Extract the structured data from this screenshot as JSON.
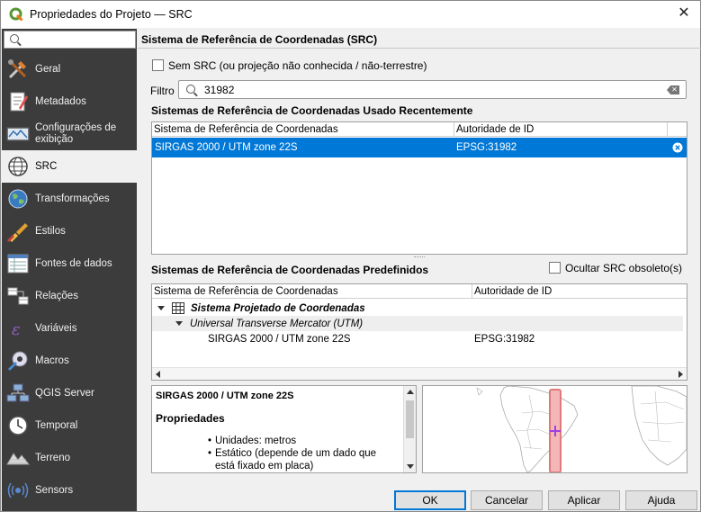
{
  "window": {
    "title": "Propriedades do Projeto — SRC"
  },
  "sidebar": {
    "search_placeholder": "",
    "items": [
      {
        "label": "Geral",
        "icon": "tools-icon"
      },
      {
        "label": "Metadados",
        "icon": "metadata-icon"
      },
      {
        "label": "Configurações de exibição",
        "icon": "display-settings-icon"
      },
      {
        "label": "SRC",
        "icon": "globe-icon"
      },
      {
        "label": "Transformações",
        "icon": "transform-globe-icon"
      },
      {
        "label": "Estilos",
        "icon": "brush-icon"
      },
      {
        "label": "Fontes de dados",
        "icon": "data-sources-icon"
      },
      {
        "label": "Relações",
        "icon": "relations-icon"
      },
      {
        "label": "Variáveis",
        "icon": "variables-icon"
      },
      {
        "label": "Macros",
        "icon": "macros-icon"
      },
      {
        "label": "QGIS Server",
        "icon": "server-icon"
      },
      {
        "label": "Temporal",
        "icon": "clock-icon"
      },
      {
        "label": "Terreno",
        "icon": "terrain-icon"
      },
      {
        "label": "Sensors",
        "icon": "sensor-icon"
      }
    ],
    "active_index": 3
  },
  "main": {
    "header": "Sistema de Referência de Coordenadas (SRC)",
    "no_crs_label": "Sem SRC (ou projeção não conhecida / não-terrestre)",
    "filter_label": "Filtro",
    "filter_value": "31982",
    "recent": {
      "title": "Sistemas de Referência de Coordenadas Usado Recentemente",
      "col_crs": "Sistema de Referência de Coordenadas",
      "col_auth": "Autoridade de ID",
      "rows": [
        {
          "crs": "SIRGAS 2000 / UTM zone 22S",
          "auth": "EPSG:31982"
        }
      ]
    },
    "predefined": {
      "title": "Sistemas de Referência de Coordenadas Predefinidos",
      "hide_deprecated_label": "Ocultar SRC obsoleto(s)",
      "col_crs": "Sistema de Referência de Coordenadas",
      "col_auth": "Autoridade de ID",
      "group": "Sistema Projetado de Coordenadas",
      "subgroup": "Universal Transverse Mercator (UTM)",
      "item_crs": "SIRGAS 2000 / UTM zone 22S",
      "item_auth": "EPSG:31982"
    },
    "info": {
      "name": "SIRGAS 2000 / UTM zone 22S",
      "props_title": "Propriedades",
      "bullet1": "Unidades: metros",
      "bullet2": "Estático (depende de um dado que está fixado em placa)"
    }
  },
  "buttons": {
    "ok": "OK",
    "cancel": "Cancelar",
    "apply": "Aplicar",
    "help": "Ajuda"
  },
  "colors": {
    "selection": "#0078d7",
    "sidebar_bg": "#3c3c3c",
    "extent": "#e07a7a",
    "crosshair": "#a040e0"
  }
}
